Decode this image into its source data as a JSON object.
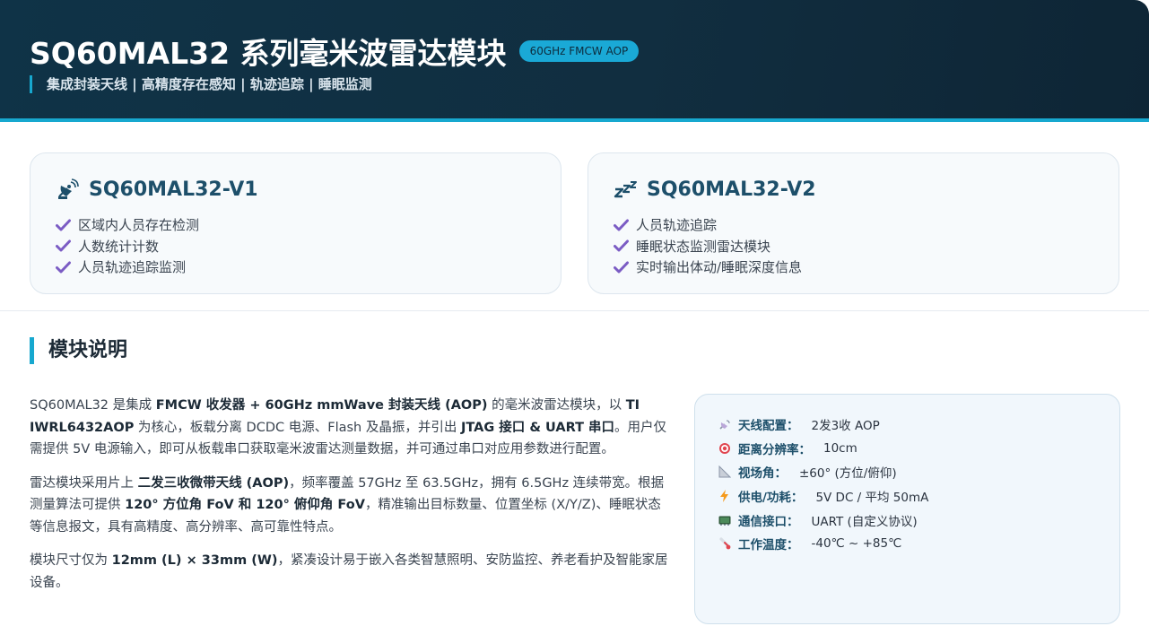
{
  "header": {
    "title": "SQ60MAL32 系列毫米波雷达模块",
    "badge": "60GHz FMCW AOP",
    "subtitle": "集成封装天线 | 高精度存在感知 | 轨迹追踪 | 睡眠监测"
  },
  "cards": [
    {
      "icon": "satellite-dish-icon",
      "title": "SQ60MAL32-V1",
      "features": [
        "区域内人员存在检测",
        "人数统计计数",
        "人员轨迹追踪监测"
      ]
    },
    {
      "icon": "sleep-zzz-icon",
      "title": "SQ60MAL32-V2",
      "features": [
        "人员轨迹追踪",
        "睡眠状态监测雷达模块",
        "实时输出体动/睡眠深度信息"
      ]
    }
  ],
  "section": {
    "title": "模块说明"
  },
  "description": {
    "p1": {
      "t1": "SQ60MAL32 是集成 ",
      "b1": "FMCW 收发器 + 60GHz mmWave 封装天线 (AOP)",
      "t2": " 的毫米波雷达模块，以 ",
      "b2": "TI IWRL6432AOP",
      "t3": " 为核心，板载分离 DCDC 电源、Flash 及晶振，并引出 ",
      "b3": "JTAG 接口 & UART 串口",
      "t4": "。用户仅需提供 5V 电源输入，即可从板载串口获取毫米波雷达测量数据，并可通过串口对应用参数进行配置。"
    },
    "p2": {
      "t1": "雷达模块采用片上 ",
      "b1": "二发三收微带天线 (AOP)",
      "t2": "，频率覆盖 57GHz 至 63.5GHz，拥有 6.5GHz 连续带宽。根据测量算法可提供 ",
      "b2": "120° 方位角 FoV 和 120° 俯仰角 FoV",
      "t3": "，精准输出目标数量、位置坐标 (X/Y/Z)、睡眠状态等信息报文，具有高精度、高分辨率、高可靠性特点。"
    },
    "p3": {
      "t1": "模块尺寸仅为 ",
      "b1": "12mm (L) × 33mm (W)",
      "t2": "，紧凑设计易于嵌入各类智慧照明、安防监控、养老看护及智能家居设备。"
    }
  },
  "specs": [
    {
      "icon": "antenna-icon",
      "label": "天线配置：",
      "value": "2发3收 AOP"
    },
    {
      "icon": "target-icon",
      "label": "距离分辨率：",
      "value": "10cm"
    },
    {
      "icon": "angle-icon",
      "label": "视场角：",
      "value": "±60° (方位/俯仰)"
    },
    {
      "icon": "lightning-icon",
      "label": "供电/功耗：",
      "value": "5V DC / 平均 50mA"
    },
    {
      "icon": "chip-icon",
      "label": "通信接口：",
      "value": "UART (自定义协议)"
    },
    {
      "icon": "thermometer-icon",
      "label": "工作温度：",
      "value": "-40℃ ~ +85℃"
    }
  ],
  "colors": {
    "header_bg": "#0f3347",
    "accent": "#17a8cf",
    "check": "#7b5cc4",
    "card_title": "#1d4f6a"
  }
}
